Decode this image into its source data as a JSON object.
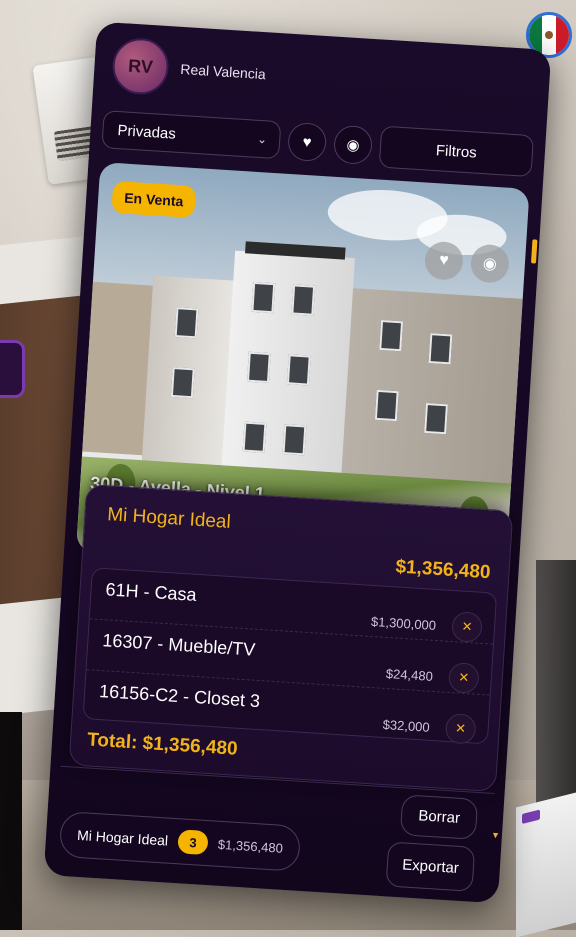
{
  "brand": {
    "initials": "RV",
    "name": "Real Valencia"
  },
  "filters": {
    "category_selected": "Privadas",
    "filters_label": "Filtros"
  },
  "listing": {
    "status_badge": "En Venta",
    "caption": "30D - Avella - Nivel 1"
  },
  "cart": {
    "title": "Mi Hogar Ideal",
    "amount": "$1,356,480",
    "items": [
      {
        "name": "61H - Casa",
        "price": "$1,300,000"
      },
      {
        "name": "16307 - Mueble/TV",
        "price": "$24,480"
      },
      {
        "name": "16156-C2 - Closet 3",
        "price": "$32,000"
      }
    ],
    "total": "Total: $1,356,480",
    "clear_label": "Borrar"
  },
  "footer": {
    "summary_name": "Mi Hogar Ideal",
    "summary_count": "3",
    "summary_amount": "$1,356,480",
    "export_label": "Exportar"
  },
  "icons": {
    "favorite": "heart-icon",
    "view": "eye-icon",
    "dropdown": "chevron-down-icon",
    "remove": "close-icon",
    "language": "mexico-flag-icon"
  },
  "colors": {
    "accent": "#f2b31a",
    "panel": "#1b0b2a",
    "badge": "#f4b400"
  }
}
